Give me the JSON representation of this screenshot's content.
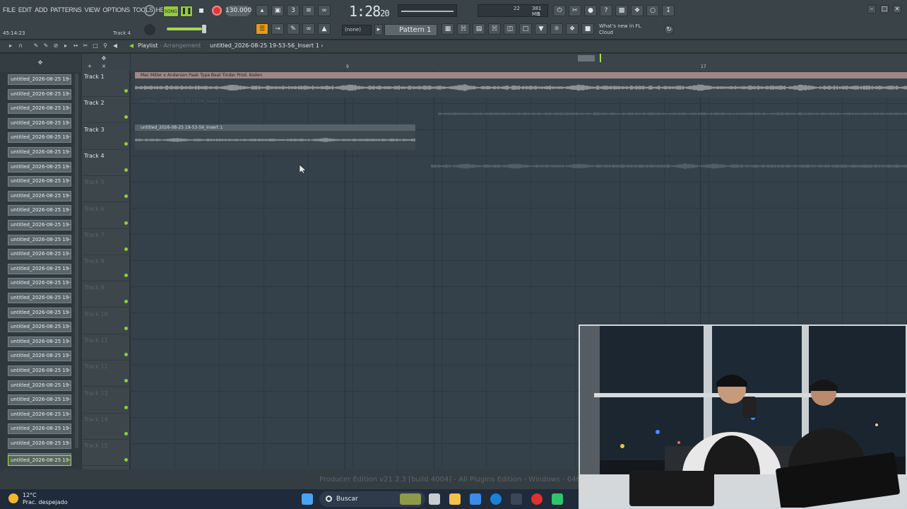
{
  "menu": [
    "FILE",
    "EDIT",
    "ADD",
    "PATTERNS",
    "VIEW",
    "OPTIONS",
    "TOOLS",
    "HELP"
  ],
  "hint": {
    "time": "45:14:23",
    "track": "Track 4"
  },
  "transport": {
    "mode": "SONG",
    "tempo": "130.000",
    "time": "1:28",
    "time_small": "20"
  },
  "cpu": {
    "voices": "22",
    "mem": "381 MB",
    "cpu": "1"
  },
  "snap": "(none)",
  "pattern": "Pattern 1",
  "news": {
    "line1": "What's new in FL",
    "line2": "Cloud"
  },
  "playlist": {
    "title": "Playlist",
    "subtitle": "Arrangement",
    "project": "untitled_2026-08-25 19-53-56_Insert 1"
  },
  "ruler": {
    "bar_a": "9",
    "bar_b": "17"
  },
  "browser_item": "untitled_2026-08-25 19-",
  "browser_count": 28,
  "tracks": [
    "Track 1",
    "Track 2",
    "Track 3",
    "Track 4",
    "Track 5",
    "Track 6",
    "Track 7",
    "Track 8",
    "Track 9",
    "Track 10",
    "Track 11",
    "Track 12",
    "Track 13",
    "Track 14",
    "Track 15"
  ],
  "clips": {
    "clip1": "Mac Miller x Anderson Paak Type Beat Tinder  Prod. Koden",
    "clip2": "untitled_2026-08-25 19-53-56_Insert 1",
    "clip3": "untitled_2026-08-25 19-53-56_Insert 1"
  },
  "build": "Producer Edition v21.2.3 [build 4004] - All Plugins Edition - Windows - 64Bit",
  "taskbar": {
    "weather_temp": "12°C",
    "weather_desc": "Prac. despejado",
    "search": "Buscar"
  },
  "colors": {
    "accent_green": "#96c93d",
    "record": "#e03636",
    "clip_header": "#9d8885"
  }
}
